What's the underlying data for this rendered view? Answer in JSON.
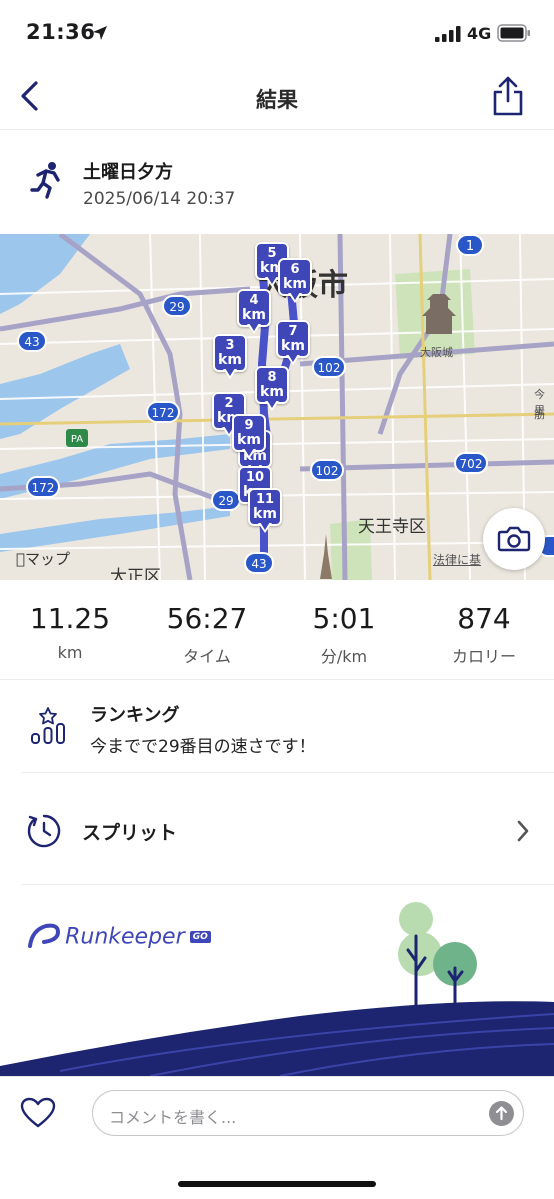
{
  "status_bar": {
    "time": "21:36",
    "network": "4G"
  },
  "nav": {
    "title": "結果"
  },
  "activity": {
    "title": "土曜日夕方",
    "datetime": "2025/06/14 20:37"
  },
  "map": {
    "labels": {
      "city": "大阪市",
      "castle": "大阪城",
      "tennoji": "天王寺区",
      "taisho": "大正区",
      "imazato": "今里",
      "suji": "筋",
      "attribution": "マップ",
      "legal": "法律に基",
      "pa": "PA"
    },
    "route_shields": [
      "1",
      "29",
      "43",
      "172",
      "102",
      "102",
      "702",
      "172",
      "29",
      "43"
    ],
    "km_markers": [
      {
        "num": "1",
        "unit": "km"
      },
      {
        "num": "2",
        "unit": "km"
      },
      {
        "num": "3",
        "unit": "km"
      },
      {
        "num": "4",
        "unit": "km"
      },
      {
        "num": "5",
        "unit": "km"
      },
      {
        "num": "6",
        "unit": "km"
      },
      {
        "num": "7",
        "unit": "km"
      },
      {
        "num": "8",
        "unit": "km"
      },
      {
        "num": "9",
        "unit": "km"
      },
      {
        "num": "10",
        "unit": "km"
      },
      {
        "num": "11",
        "unit": "km"
      }
    ]
  },
  "stats": [
    {
      "value": "11.25",
      "label": "km"
    },
    {
      "value": "56:27",
      "label": "タイム"
    },
    {
      "value": "5:01",
      "label": "分/km"
    },
    {
      "value": "874",
      "label": "カロリー"
    }
  ],
  "ranking": {
    "title": "ランキング",
    "text": "今までで29番目の速さです！"
  },
  "splits": {
    "label": "スプリット"
  },
  "brand": {
    "name": "Runkeeper",
    "badge": "GO"
  },
  "comment": {
    "placeholder": "コメントを書く..."
  },
  "colors": {
    "accent": "#3f46b8",
    "navy": "#1d2470",
    "route": "#4a52c9"
  }
}
